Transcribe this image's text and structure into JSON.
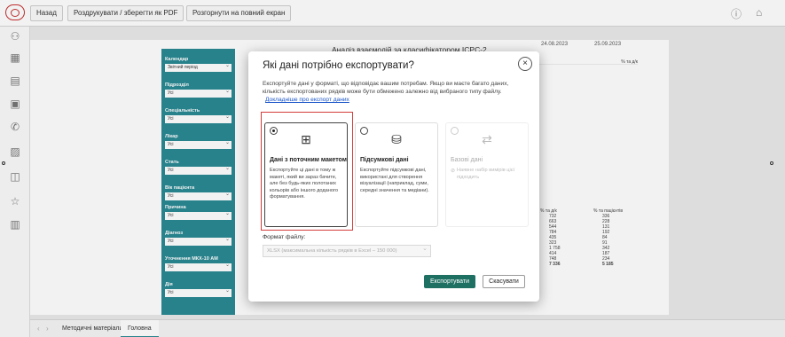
{
  "toolbar": {
    "back_label": "Назад",
    "print_label": "Роздрукувати / зберегти як PDF",
    "fullscreen_label": "Розгорнути на повний екран"
  },
  "report": {
    "title": "Аналіз взаємодій за класифікатором ICPC-2",
    "date_from": "24.08.2023",
    "date_to": "25.09.2023",
    "filters": [
      {
        "label": "Календар",
        "value": "Звітний період"
      },
      {
        "label": "Підрозділ",
        "value": "Усі"
      },
      {
        "label": "Спеціальність",
        "value": "Усі"
      },
      {
        "label": "Лікар",
        "value": "Усі"
      },
      {
        "label": "Стать",
        "value": "Усі"
      },
      {
        "label": "Вік пацієнта",
        "value": "Усі"
      },
      {
        "label": "Причина",
        "value": "Усі"
      },
      {
        "label": "Діагноз",
        "value": "Усі"
      },
      {
        "label": "Уточнення МКХ-10 АМ",
        "value": "Усі"
      },
      {
        "label": "Дія",
        "value": "Усі"
      }
    ],
    "col_header": "% та д/к",
    "bottom_col_header": "% та пацієнтів",
    "right_values": [
      "732",
      "663",
      "544",
      "784",
      "435",
      "323",
      "1 758",
      "414",
      "748",
      "7 336"
    ],
    "right_values_2": [
      "336",
      "228",
      "131",
      "192",
      "84",
      "91",
      "342",
      "187",
      "234",
      "5 185"
    ]
  },
  "modal": {
    "title": "Які дані потрібно експортувати?",
    "description": "Експортуйте дані у форматі, що відповідає вашим потребам. Якщо ви маєте багато даних, кількість експортованих рядків може бути обмежено залежно від вибраного типу файлу.",
    "link": "Докладніше про експорт даних",
    "options": [
      {
        "title": "Дані з поточним макетом",
        "text": "Експортуйте ці дані в тому ж макеті, який ви зараз бачите, але без будь-яких полотаних кольорів або іншого доданого форматування.",
        "selected": true
      },
      {
        "title": "Підсумкові дані",
        "text": "Експортуйте підсумкові дані, використані для створення візуалізації (наприклад, суми, середні значення та медіани).",
        "selected": false
      },
      {
        "title": "Базові дані",
        "text": "Наявне набір вимірів цієї підходить",
        "selected": false,
        "disabled": true
      }
    ],
    "format_label": "Формат файлу:",
    "format_value": "XLSX (максимальна кількість рядків в Excel – 150 000)",
    "export_label": "Експортувати",
    "cancel_label": "Скасувати"
  },
  "tabs": [
    {
      "label": "Методичні матеріали",
      "active": false
    },
    {
      "label": "Головна",
      "active": true
    }
  ],
  "colors": {
    "accent": "#2a8a94",
    "primary_button": "#1d7062",
    "highlight": "#d43c3c"
  }
}
